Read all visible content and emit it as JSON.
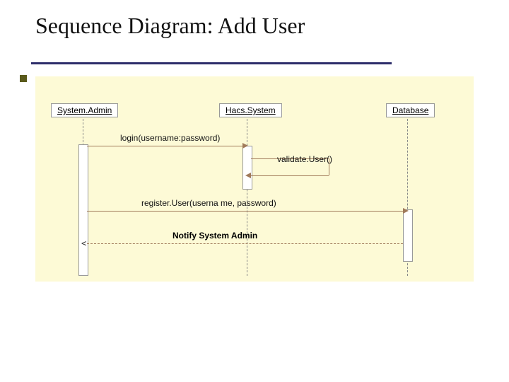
{
  "title": "Sequence Diagram: Add User",
  "participants": {
    "p1": "System.Admin",
    "p2": "Hacs.System",
    "p3": "Database"
  },
  "messages": {
    "login": "login(username:password)",
    "validate": "validate.User()",
    "register": "register.User(userna me, password)",
    "notify": "Notify System Admin"
  }
}
